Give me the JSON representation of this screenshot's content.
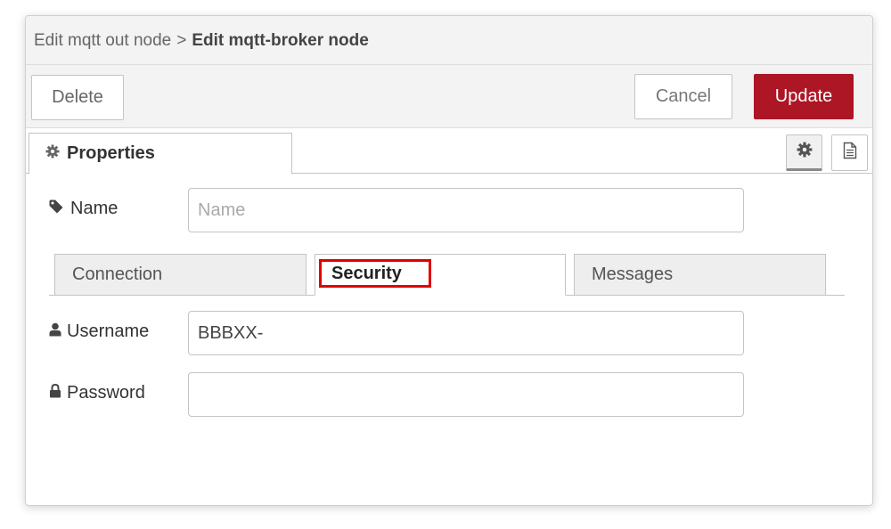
{
  "breadcrumb": {
    "parent": "Edit mqtt out node",
    "separator": ">",
    "current": "Edit mqtt-broker node"
  },
  "toolbar": {
    "delete_label": "Delete",
    "cancel_label": "Cancel",
    "update_label": "Update"
  },
  "tabs": {
    "properties_label": "Properties"
  },
  "form": {
    "name_label": "Name",
    "name_placeholder": "Name",
    "name_value": "",
    "username_label": "Username",
    "username_value": "BBBXX-",
    "password_label": "Password",
    "password_value": ""
  },
  "subtabs": [
    {
      "label": "Connection",
      "active": false
    },
    {
      "label": "Security",
      "active": true
    },
    {
      "label": "Messages",
      "active": false
    }
  ],
  "colors": {
    "accent": "#ad1625",
    "highlight": "#e00000"
  },
  "icons": [
    "gear-icon",
    "tag-icon",
    "user-icon",
    "lock-icon",
    "document-icon"
  ]
}
